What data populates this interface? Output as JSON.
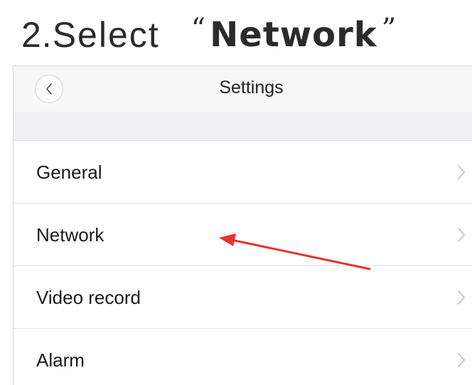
{
  "instruction": {
    "step": "2.",
    "action": "Select",
    "open_quote": "“",
    "target": "Network",
    "close_quote": "”"
  },
  "navbar": {
    "title": "Settings",
    "back_icon": "chevron-left-icon"
  },
  "settings_list": {
    "items": [
      {
        "label": "General",
        "icon": "chevron-right-icon"
      },
      {
        "label": "Network",
        "icon": "chevron-right-icon"
      },
      {
        "label": "Video record",
        "icon": "chevron-right-icon"
      },
      {
        "label": "Alarm",
        "icon": "chevron-right-icon"
      }
    ]
  },
  "annotation": {
    "arrow_color": "#e8322f",
    "points_to": "Network"
  },
  "colors": {
    "navbar_bg": "#f7f7f7",
    "section_gap_bg": "#efeff4",
    "text": "#1a1a1a",
    "chevron": "#c7c7cc"
  }
}
